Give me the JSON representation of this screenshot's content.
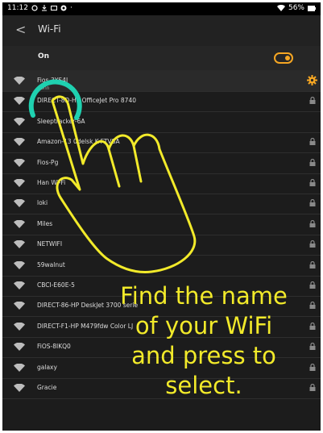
{
  "status": {
    "time": "11:12",
    "battery": "56%"
  },
  "header": {
    "back": "<",
    "title": "Wi-Fi"
  },
  "toggle": {
    "label": "On",
    "state": "on"
  },
  "colors": {
    "accent": "#f5a623",
    "caption": "#f2ea2a",
    "ring": "#1fd1b0"
  },
  "networks": [
    {
      "name": "Fios-3YS4J",
      "status": "Conn",
      "connected": true
    },
    {
      "name": "DIRECT-8D-HP OfficeJet Pro 8740",
      "locked": true
    },
    {
      "name": "Sleeptracker-6A",
      "locked": false
    },
    {
      "name": "Amazon-13 0delsk K-FTVSA",
      "locked": true
    },
    {
      "name": "Fios-Pg",
      "locked": true
    },
    {
      "name": "Han Wi-Fi",
      "locked": true
    },
    {
      "name": "loki",
      "locked": true
    },
    {
      "name": "Miles",
      "locked": true
    },
    {
      "name": "NETWIFI",
      "locked": true
    },
    {
      "name": "59walnut",
      "locked": true
    },
    {
      "name": "CBCI-E60E-5",
      "locked": true
    },
    {
      "name": "DIRECT-86-HP DeskJet 3700 serie",
      "locked": true
    },
    {
      "name": "DIRECT-F1-HP M479fdw Color LJ",
      "locked": true
    },
    {
      "name": "FiOS-8IKQ0",
      "locked": true
    },
    {
      "name": "galaxy",
      "locked": true
    },
    {
      "name": "Gracie",
      "locked": true
    }
  ],
  "caption": {
    "line1": "Find the name",
    "line2": "of your WiFi",
    "line3": "and press to",
    "line4": "select."
  }
}
